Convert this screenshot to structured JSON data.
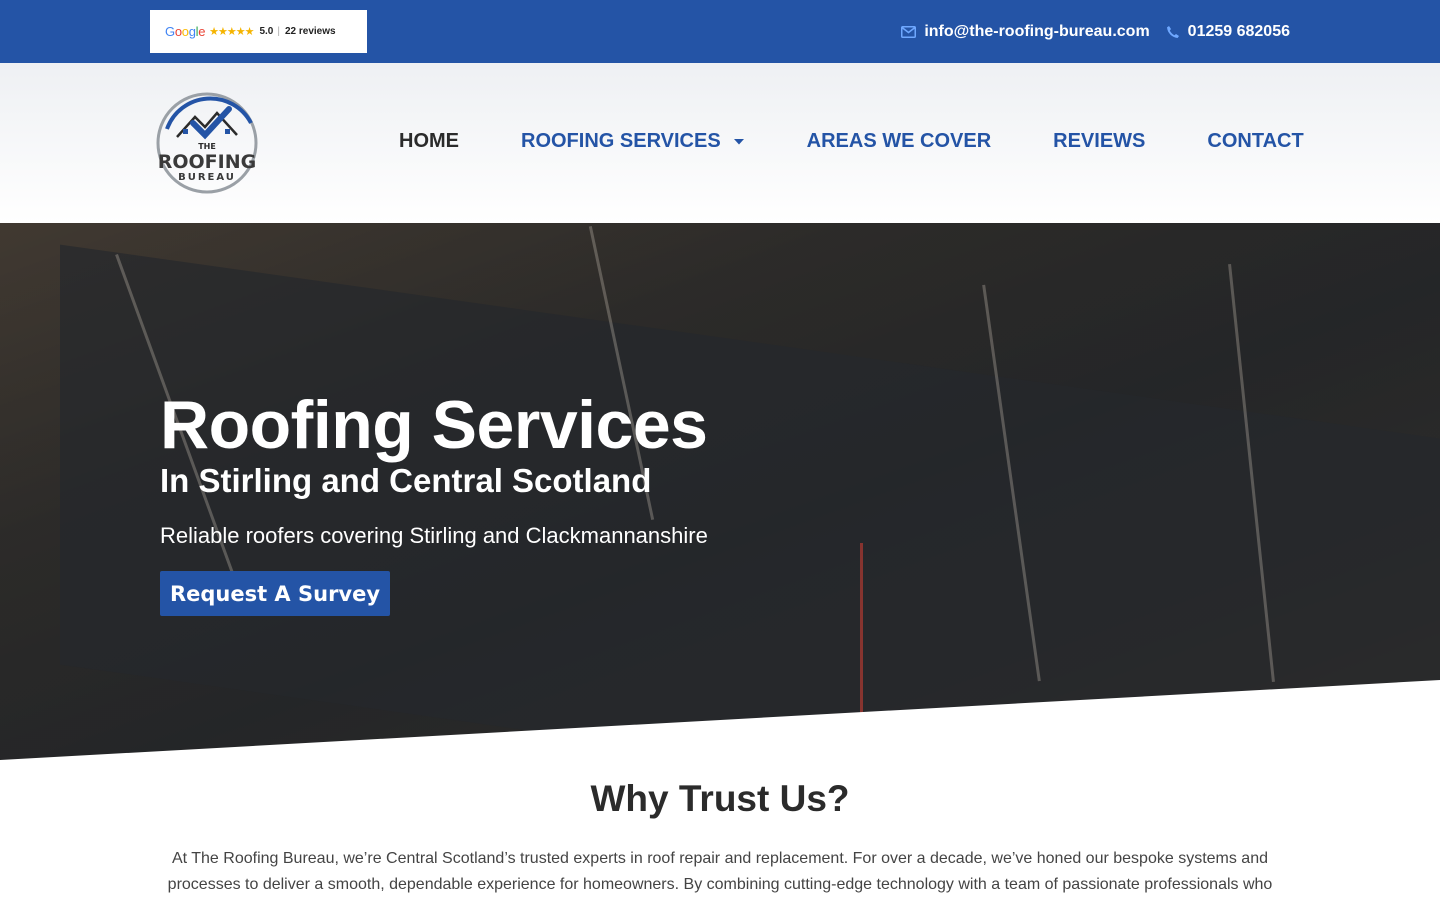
{
  "topbar": {
    "review_badge": {
      "google_letters": [
        "G",
        "o",
        "o",
        "g",
        "l",
        "e"
      ],
      "google_colors": [
        "#4285F4",
        "#EA4335",
        "#FBBC05",
        "#4285F4",
        "#34A853",
        "#EA4335"
      ],
      "stars": "★★★★★",
      "rating": "5.0",
      "separator": "|",
      "review_count": "22 reviews"
    },
    "email": "info@the-roofing-bureau.com",
    "phone": "01259 682056",
    "email_icon": "envelope-icon",
    "phone_icon": "phone-icon",
    "accent_color": "#2454a6"
  },
  "header": {
    "logo": {
      "line1": "THE",
      "line2": "ROOFING",
      "line3": "BUREAU"
    },
    "nav": [
      {
        "label": "HOME",
        "active": true
      },
      {
        "label": "ROOFING SERVICES",
        "dropdown": true
      },
      {
        "label": "AREAS WE COVER"
      },
      {
        "label": "REVIEWS"
      },
      {
        "label": "CONTACT"
      }
    ]
  },
  "hero": {
    "title": "Roofing Services",
    "subtitle": "In Stirling and Central Scotland",
    "text": "Reliable roofers covering Stirling and Clackmannanshire",
    "cta_label": "Request A Survey"
  },
  "why": {
    "title": "Why Trust Us?",
    "text": "At The Roofing Bureau, we’re Central Scotland’s trusted experts in roof repair and replacement. For over a decade, we’ve honed our bespoke systems and processes to deliver a smooth, dependable experience for homeowners. By combining cutting-edge technology with a team of passionate professionals who"
  }
}
